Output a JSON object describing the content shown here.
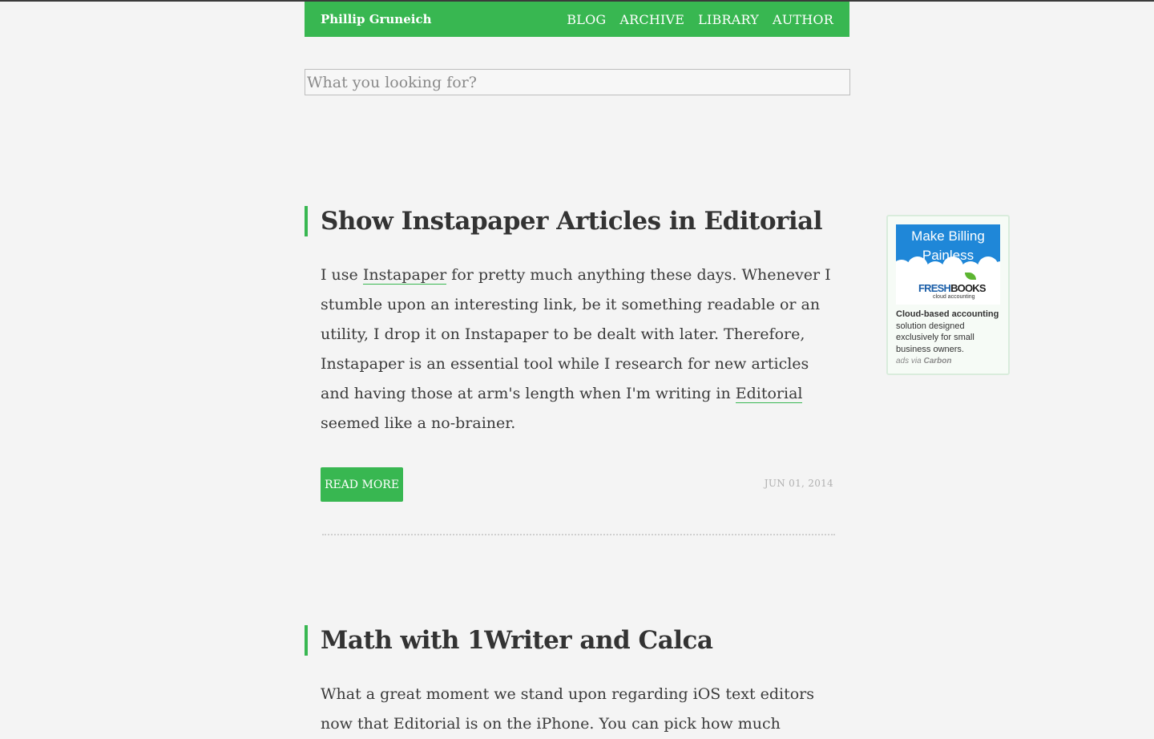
{
  "header": {
    "site_title": "Phillip Gruneich",
    "nav": [
      "BLOG",
      "ARCHIVE",
      "LIBRARY",
      "AUTHOR"
    ]
  },
  "search": {
    "placeholder": "What you looking for?",
    "value": ""
  },
  "posts": [
    {
      "title": "Show Instapaper Articles in Editorial",
      "excerpt": {
        "t1": "I use ",
        "link1": "Instapaper",
        "t2": " for pretty much anything these days. Whenever I stumble upon an interesting link, be it something readable or an utility, I drop it on Instapaper to be dealt with later. Therefore, Instapaper is an essential tool while I research for new articles and having those at arm's length when I'm writing in ",
        "link2": "Editorial",
        "t3": " seemed like a no-brainer."
      },
      "read_more": "READ MORE",
      "date": "JUN 01, 2014"
    },
    {
      "title": "Math with 1Writer and Calca",
      "excerpt": {
        "t1": "What a great moment we stand upon regarding iOS text editors now that Editorial is on the iPhone. You can pick how much"
      }
    }
  ],
  "ad": {
    "banner_headline": "Make Billing Painless",
    "logo_fresh": "FRESH",
    "logo_books": "BOOKS",
    "logo_sub": "cloud accounting",
    "copy_lead": "Cloud-based accounting",
    "copy_rest": " solution designed exclusively for small business owners.",
    "via_prefix": "ads via ",
    "via_brand": "Carbon"
  },
  "colors": {
    "accent": "#38b751",
    "background": "#f4f4f4",
    "ad_blue": "#1f87d8"
  }
}
